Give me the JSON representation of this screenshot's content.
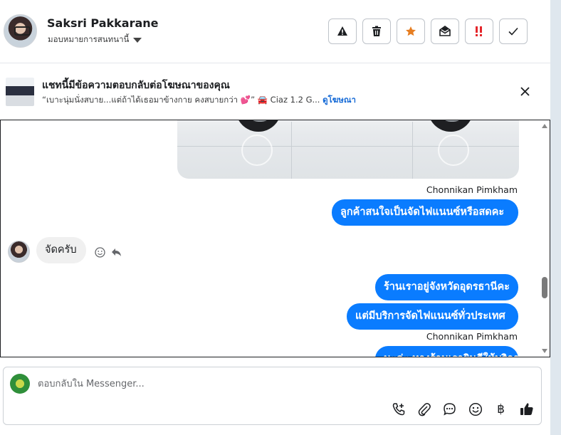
{
  "header": {
    "contact_name": "Saksri Pakkarane",
    "assign_label": "มอบหมายการสนทนานี้",
    "actions": [
      "mark-spam-icon",
      "trash-icon",
      "star-icon",
      "mark-unread-icon",
      "follow-up-icon",
      "done-icon"
    ]
  },
  "ad_banner": {
    "title": "แชทนี้มีข้อความตอบกลับต่อโฆษณาของคุณ",
    "snippet": "“เบาะนุ่มนั่งสบาย...แต่ถ้าได้เธอมาข้างกาย คงสบายกว่า 💕” 🚘 Ciaz 1.2 G...",
    "link_label": "ดูโฆษณา"
  },
  "conversation": {
    "messages": [
      {
        "sender": "Chonnikan Pimkham",
        "direction": "out",
        "text": "ลูกค้าสนใจเป็นจัดไฟแนนซ์หรือสดคะ"
      },
      {
        "direction": "in",
        "text": "จัดครับ"
      },
      {
        "direction": "out",
        "text": "ร้านเราอยู่จังหวัดอุดรธานีคะ"
      },
      {
        "direction": "out",
        "text": "แต่มีบริการจัดไฟแนนซ์ทั่วประเทศ"
      },
      {
        "sender": "Chonnikan Pimkham",
        "direction": "out",
        "text": "นะค่ะ ทางร้านเรายินดีให้บริการ"
      }
    ]
  },
  "composer": {
    "placeholder": "ตอบกลับใน Messenger...",
    "currency_symbol": "฿",
    "tools": [
      "call-add-icon",
      "attachment-icon",
      "saved-reply-icon",
      "emoji-icon",
      "baht-icon",
      "thumbs-up-icon"
    ]
  },
  "colors": {
    "accent": "#0a7cff",
    "follow_up": "#e4262b",
    "star": "#e67e22"
  }
}
